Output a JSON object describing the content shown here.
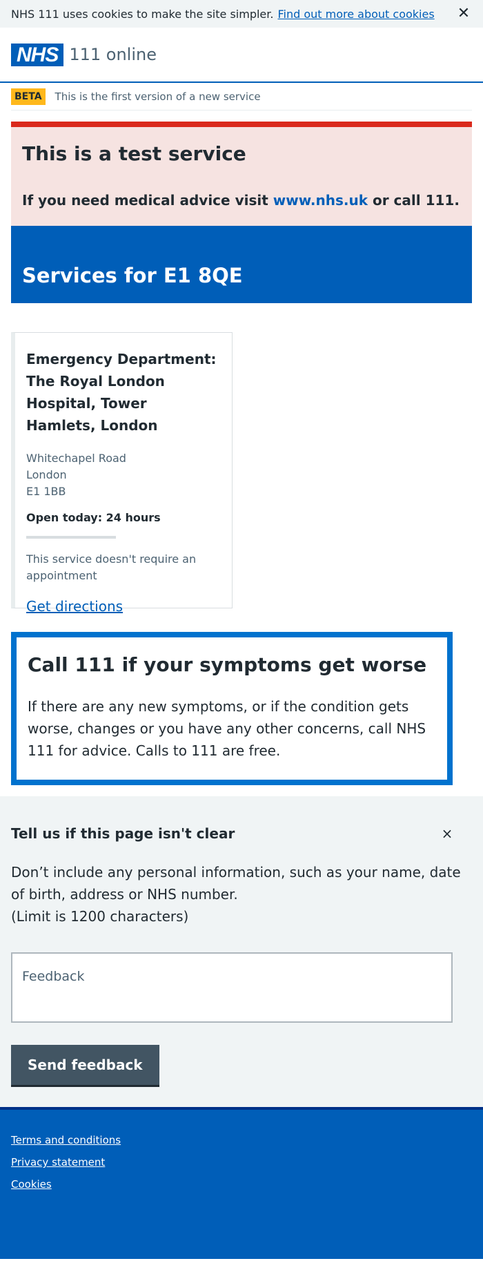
{
  "cookie_banner": {
    "text": "NHS 111 uses cookies to make the site simpler.",
    "link": "Find out more about cookies",
    "close_symbol": "✕"
  },
  "header": {
    "logo": "NHS",
    "service_name": "111 online"
  },
  "beta": {
    "tag": "BETA",
    "text": "This is the first version of a new service"
  },
  "test_service": {
    "title": "This is a test service",
    "body_prefix": "If you need medical advice visit",
    "link": "www.nhs.uk",
    "body_suffix": "or call 111."
  },
  "hero": {
    "title": "Services for E1 8QE"
  },
  "service_card": {
    "title": "Emergency Department: The Royal London Hospital, Tower Hamlets, London",
    "address": [
      "Whitechapel Road",
      "London",
      "E1 1BB"
    ],
    "open_today": "Open today: 24 hours",
    "appointment": "This service doesn't require an appointment",
    "directions": "Get directions"
  },
  "care_card": {
    "title": "Call 111 if your symptoms get worse",
    "body": "If there are any new symptoms, or if the condition gets worse, changes or you have any other concerns, call NHS 111 for advice. Calls to 111 are free."
  },
  "feedback": {
    "title": "Tell us if this page isn't clear",
    "close_symbol": "×",
    "info": "Don’t include any personal information, such as your name, date of birth, address or NHS number.",
    "limit": "(Limit is 1200 characters)",
    "placeholder": "Feedback",
    "button": "Send feedback"
  },
  "footer": {
    "links": [
      "Terms and conditions",
      "Privacy statement",
      "Cookies"
    ]
  },
  "colors": {
    "nhs_blue": "#005eb8",
    "warning_red": "#da291c",
    "warning_bg": "#f6e3e1",
    "beta_yellow": "#ffb81c",
    "care_border": "#0072ce",
    "button_grey": "#425563",
    "footer_border": "#003087"
  }
}
